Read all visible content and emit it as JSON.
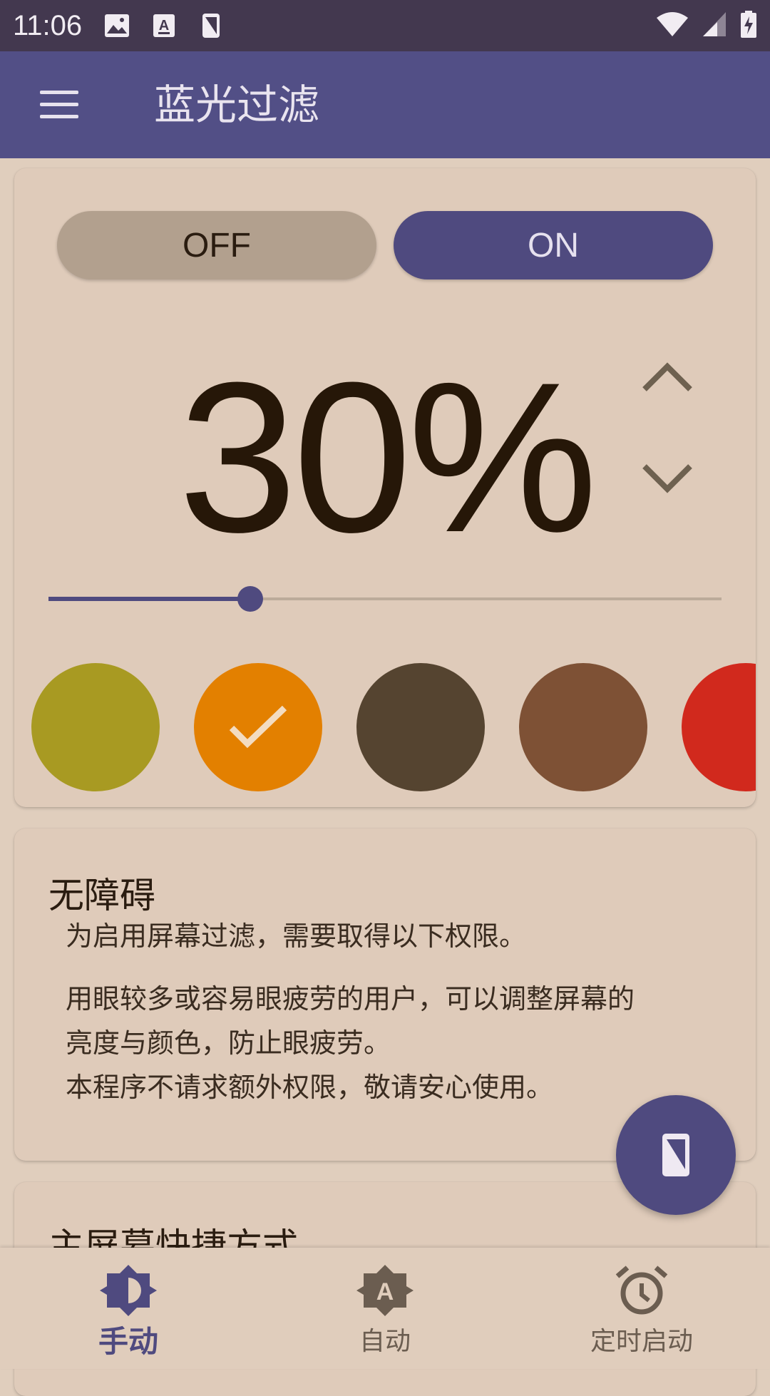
{
  "status_bar": {
    "time": "11:06",
    "icons": [
      "image-icon",
      "font-a-icon",
      "screen-filter-icon"
    ],
    "right_icons": [
      "wifi-icon",
      "signal-icon",
      "battery-charging-icon"
    ]
  },
  "app_bar": {
    "title": "蓝光过滤",
    "menu_icon": "hamburger-menu-icon"
  },
  "filter_card": {
    "off_label": "OFF",
    "on_label": "ON",
    "state": "ON",
    "percent_text": "30%",
    "level": 30,
    "level_min": 0,
    "level_max": 100,
    "colors": [
      {
        "name": "olive",
        "hex": "#a89a22",
        "selected": false
      },
      {
        "name": "orange",
        "hex": "#e38000",
        "selected": true
      },
      {
        "name": "dark-brown",
        "hex": "#554430",
        "selected": false
      },
      {
        "name": "brown",
        "hex": "#7e5135",
        "selected": false
      },
      {
        "name": "red",
        "hex": "#d1291d",
        "selected": false
      }
    ],
    "accent": "#4f4a7f"
  },
  "accessibility_card": {
    "heading": "无障碍",
    "line1": "为启用屏幕过滤，需要取得以下权限。",
    "line2": "用眼较多或容易眼疲劳的用户，可以调整屏幕的",
    "line3": "亮度与颜色，防止眼疲劳。",
    "line4": "本程序不请求额外权限，敬请安心使用。"
  },
  "shortcut_card": {
    "heading": "主屏幕快捷方式"
  },
  "fab": {
    "icon": "screen-filter-icon"
  },
  "bottom_nav": {
    "items": [
      {
        "label": "手动",
        "icon": "brightness-icon",
        "active": true
      },
      {
        "label": "自动",
        "icon": "auto-brightness-icon",
        "active": false
      },
      {
        "label": "定时启动",
        "icon": "alarm-clock-icon",
        "active": false
      }
    ]
  }
}
